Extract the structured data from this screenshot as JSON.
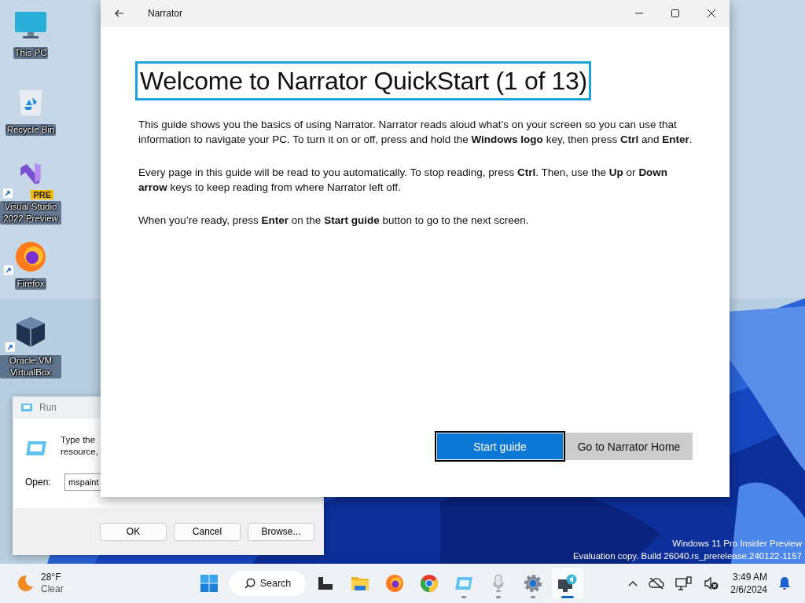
{
  "desktop_icons": [
    {
      "label": "This PC",
      "kind": "pc",
      "shortcut": false
    },
    {
      "label": "Recycle Bin",
      "kind": "recycle",
      "shortcut": false
    },
    {
      "label": "Visual Studio 2022 Preview",
      "kind": "vs",
      "badge": "PRE",
      "shortcut": true
    },
    {
      "label": "Firefox",
      "kind": "firefox",
      "shortcut": true
    },
    {
      "label": "Oracle VM VirtualBox",
      "kind": "virtualbox",
      "shortcut": true
    }
  ],
  "run_dialog": {
    "title": "Run",
    "lines": [
      "Type the",
      "resource,"
    ],
    "open_label": "Open:",
    "value": "mspaint",
    "buttons": [
      "OK",
      "Cancel",
      "Browse..."
    ]
  },
  "narrator_window": {
    "title": "Narrator",
    "heading": "Welcome to Narrator QuickStart (1 of 13)",
    "heading_focused": true,
    "paragraphs": [
      "This guide shows you the basics of using Narrator. Narrator reads aloud what’s on your screen so you can use that information to navigate your PC. To turn it on or off, press and hold the **Windows logo** key, then press **Ctrl** and **Enter**.",
      "Every page in this guide will be read to you automatically. To stop reading, press **Ctrl**. Then, use the **Up** or **Down arrow** keys to keep reading from where Narrator left off.",
      "When you’re ready, press **Enter** on the **Start guide** button to go to the next screen."
    ],
    "buttons": [
      {
        "label": "Start guide",
        "kind": "primary"
      },
      {
        "label": "Go to Narrator Home",
        "kind": "secondary"
      }
    ]
  },
  "system_notice": [
    "Windows 11 Pro Insider Preview",
    "Evaluation copy. Build 26040.rs_prerelease.240122-1157"
  ],
  "taskbar": {
    "weather": {
      "temperature": "28°F",
      "condition": "Clear"
    },
    "search_label": "Search",
    "apps": [
      {
        "kind": "start",
        "running": false,
        "selected": false
      },
      {
        "kind": "taskview",
        "running": false,
        "selected": false
      },
      {
        "kind": "explorer",
        "running": false,
        "selected": false
      },
      {
        "kind": "firefox",
        "running": false,
        "selected": false
      },
      {
        "kind": "chrome",
        "running": false,
        "selected": false
      },
      {
        "kind": "run",
        "running": true,
        "selected": false
      },
      {
        "kind": "mic",
        "running": true,
        "selected": false
      },
      {
        "kind": "settings",
        "running": true,
        "selected": false
      },
      {
        "kind": "narrator",
        "running": true,
        "selected": true
      }
    ],
    "time": "3:49 AM",
    "date": "2/6/2024"
  }
}
